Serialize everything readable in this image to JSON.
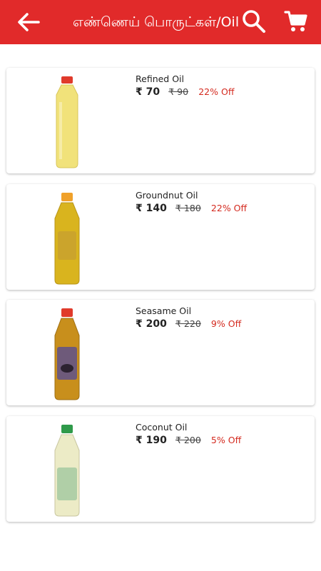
{
  "appbar": {
    "title": "எண்ணெய் பொருட்கள்/Oil",
    "back_icon": "arrow-left-icon",
    "search_icon": "search-icon",
    "cart_icon": "cart-icon",
    "background": "#e12a2a"
  },
  "products": [
    {
      "name": "Refined Oil",
      "price": "₹ 70",
      "mrp": "₹ 90",
      "discount": "22% Off",
      "cap_color": "#e03a2b",
      "oil_color": "#f1e27a"
    },
    {
      "name": "Groundnut Oil",
      "price": "₹ 140",
      "mrp": "₹ 180",
      "discount": "22% Off",
      "cap_color": "#f0a12a",
      "oil_color": "#d9b41e"
    },
    {
      "name": "Seasame Oil",
      "price": "₹ 200",
      "mrp": "₹ 220",
      "discount": "9% Off",
      "cap_color": "#e03a2b",
      "oil_color": "#c88f1c"
    },
    {
      "name": "Coconut Oil",
      "price": "₹ 190",
      "mrp": "₹ 200",
      "discount": "5% Off",
      "cap_color": "#2f9a4a",
      "oil_color": "#ecebc6"
    }
  ]
}
